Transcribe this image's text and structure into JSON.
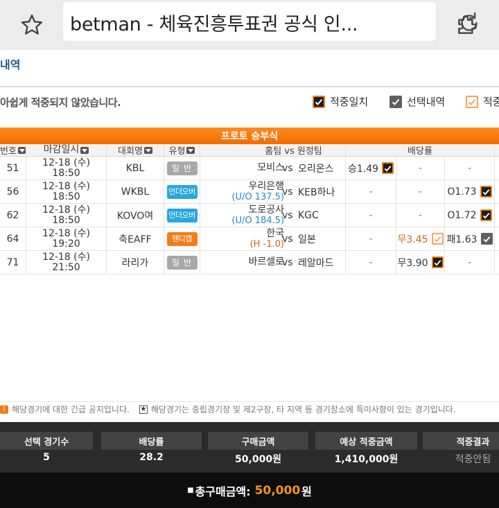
{
  "browser": {
    "title": "betman - 체육진흥투표권 공식 인...",
    "icons": [
      "star-icon",
      "reload-icon",
      "extension-icon"
    ]
  },
  "page": {
    "section_title": "내역",
    "notice": "아쉽게 적중되지  않았습니다.",
    "legend": [
      "적중일치",
      "선택내역",
      "적중"
    ]
  },
  "table": {
    "title": "프로토 승부식",
    "headers": {
      "no": "번호",
      "date": "마감일시",
      "league": "대회명",
      "type": "유형",
      "match": "홈팀  vs  원정팀",
      "odds": "배당률"
    },
    "rows": [
      {
        "no": "51",
        "date1": "12-18 (수)",
        "date2": "18:50",
        "league": "KBL",
        "type": "일 반",
        "home": "모비스",
        "home_sub": "",
        "vs": "vs",
        "away": "오리온스",
        "o1": "승1.49",
        "o1_mark": "orange",
        "o2": "-",
        "o2_mark": "",
        "o3": "-",
        "o3_mark": ""
      },
      {
        "no": "56",
        "date1": "12-18 (수)",
        "date2": "18:50",
        "league": "WKBL",
        "type": "언더오버",
        "home": "우리은행",
        "home_sub": "(U/O 137.5)",
        "vs": "vs",
        "away": "KEB하나",
        "o1": "-",
        "o1_mark": "",
        "o2": "-",
        "o2_mark": "",
        "o3": "O1.73",
        "o3_mark": "orange"
      },
      {
        "no": "62",
        "date1": "12-18 (수)",
        "date2": "18:50",
        "league": "KOVO여",
        "type": "언더오버",
        "home": "도로공사",
        "home_sub": "(U/O 184.5)",
        "vs": "vs",
        "away": "KGC",
        "o1": "-",
        "o1_mark": "",
        "o2": "-",
        "o2_mark": "",
        "o3": "O1.72",
        "o3_mark": "orange"
      },
      {
        "no": "64",
        "date1": "12-18 (수)",
        "date2": "19:20",
        "league": "축EAFF",
        "type": "핸디캡",
        "home": "한국",
        "home_sub": "(H -1.0)",
        "vs": "vs",
        "away": "일본",
        "o1": "-",
        "o1_mark": "",
        "o2": "무3.45",
        "o2_mark": "light",
        "o3": "패1.63",
        "o3_mark": "gray"
      },
      {
        "no": "71",
        "date1": "12-18 (수)",
        "date2": "21:50",
        "league": "라리가",
        "type": "일 반",
        "home": "바르셀로",
        "home_sub": "",
        "vs": "vs",
        "away": "레알마드",
        "o1": "-",
        "o1_mark": "",
        "o2": "무3.90",
        "o2_mark": "orange",
        "o3": "-",
        "o3_mark": ""
      }
    ]
  },
  "footnotes": {
    "urgent": "해당경기에 대한 긴급 공지입니다.",
    "star": "해당경기는 중립경기장 및 제2구장, 타 지역 등 경기장소에 특이사항이 있는 경기입니다."
  },
  "summary": {
    "labels": [
      "선택 경기수",
      "배당률",
      "구매금액",
      "예상 적중금액",
      "적중결과"
    ],
    "values": [
      "5",
      "28.2",
      "50,000원",
      "1,410,000원",
      "적중안됨"
    ]
  },
  "total": {
    "label": "총구매금액:",
    "amount": "50,000",
    "unit": "원"
  },
  "colors": {
    "accent": "#f36c00",
    "blue_link": "#1f5b8c",
    "dark_bar": "#2b2b2b"
  }
}
